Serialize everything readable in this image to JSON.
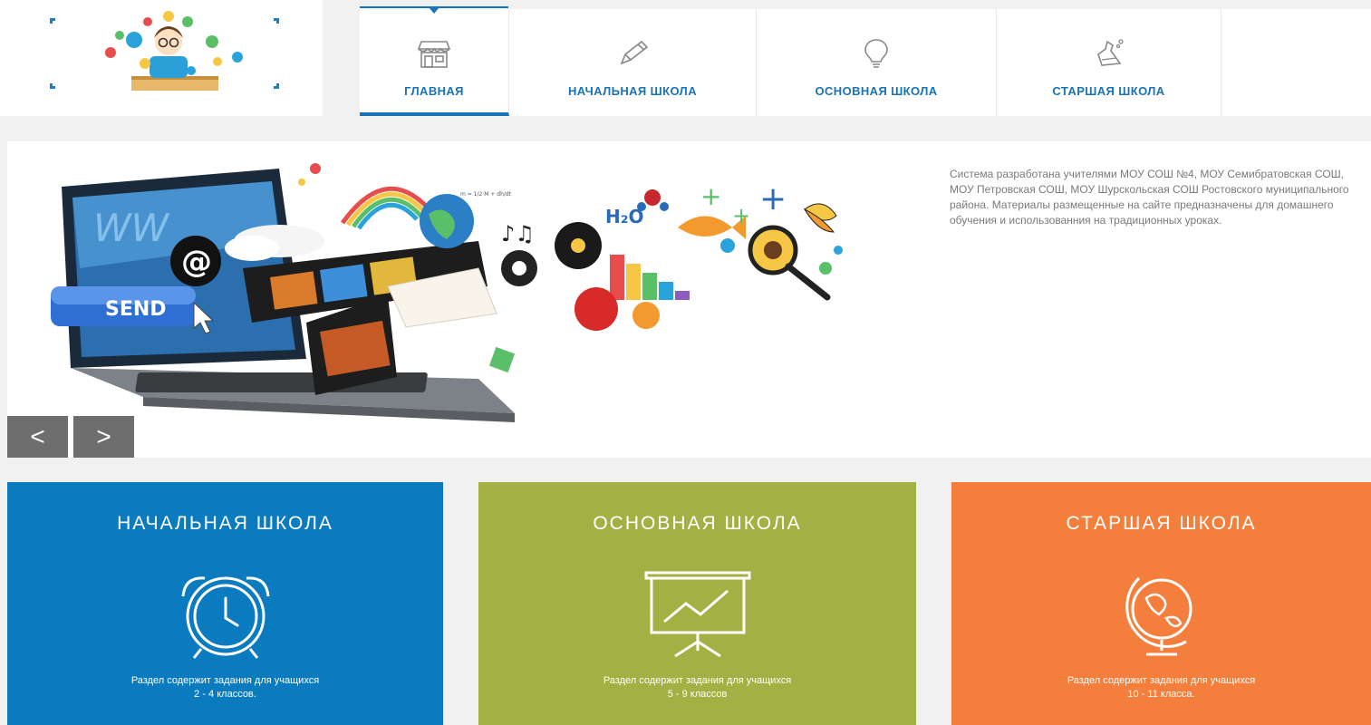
{
  "nav": {
    "items": [
      {
        "label": "ГЛАВНАЯ",
        "icon": "shop-icon",
        "active": true
      },
      {
        "label": "НАЧАЛЬНАЯ ШКОЛА",
        "icon": "pencil-icon",
        "active": false
      },
      {
        "label": "ОСНОВНАЯ ШКОЛА",
        "icon": "lightbulb-icon",
        "active": false
      },
      {
        "label": "СТАРШАЯ ШКОЛА",
        "icon": "flask-icon",
        "active": false
      }
    ]
  },
  "hero": {
    "description": "Система разработана учителями МОУ СОШ №4, МОУ Семибратовская СОШ, МОУ Петровская СОШ, МОУ Шурскольская СОШ Ростовского муниципального района. Материалы размещенные на сайте предназначены для домашнего обучения и использованния на традиционных уроках.",
    "banner": {
      "send_label": "SEND",
      "at_symbol": "@",
      "formula_label": "H₂O",
      "equation_label": "m = 1/2·M + dh/dt"
    },
    "prev_glyph": "<",
    "next_glyph": ">"
  },
  "cards": [
    {
      "title": "НАЧАЛЬНАЯ ШКОЛА",
      "icon": "alarm-clock-icon",
      "desc_line1": "Раздел содержит задания для учащихся",
      "desc_line2": "2 - 4 классов.",
      "color": "#0a7bbf"
    },
    {
      "title": "ОСНОВНАЯ ШКОЛА",
      "icon": "presentation-chart-icon",
      "desc_line1": "Раздел содержит задания для учащихся",
      "desc_line2": "5 - 9 классов",
      "color": "#a3b043"
    },
    {
      "title": "СТАРШАЯ ШКОЛА",
      "icon": "globe-icon",
      "desc_line1": "Раздел содержит задания для учащихся",
      "desc_line2": "10 - 11 класса.",
      "color": "#f47f3c"
    }
  ],
  "colors": {
    "accent_blue": "#1a73b8",
    "background": "#f1f1f1"
  }
}
